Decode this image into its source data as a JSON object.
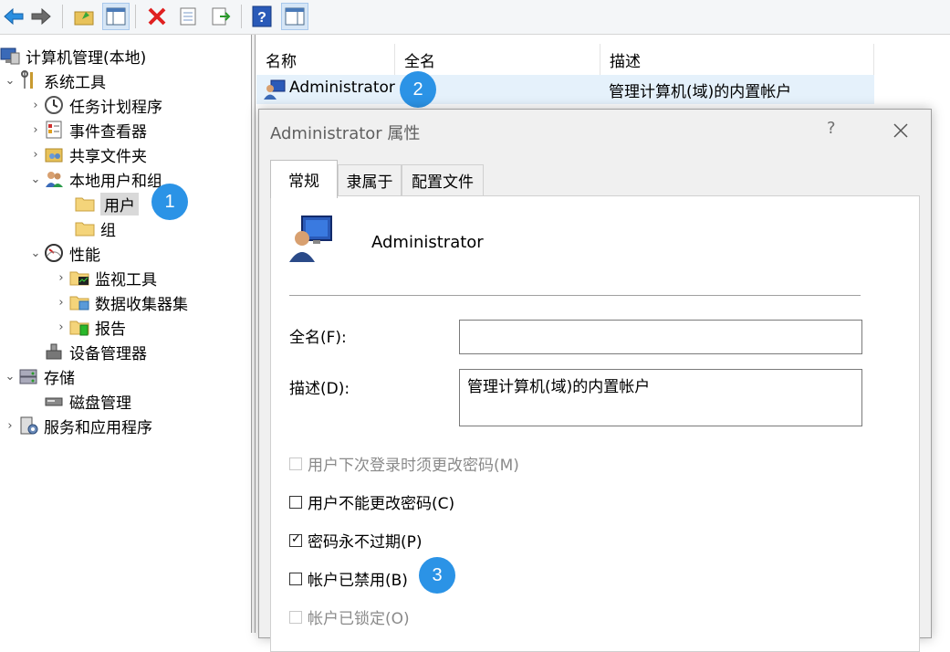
{
  "toolbar": {
    "buttons": [
      "back-icon",
      "forward-icon",
      "up-folder-icon",
      "show-hide-tree-icon",
      "delete-icon",
      "properties-icon",
      "export-icon",
      "help-icon",
      "action-pane-icon"
    ]
  },
  "tree": {
    "root": "计算机管理(本地)",
    "system_tools": "系统工具",
    "task_scheduler": "任务计划程序",
    "event_viewer": "事件查看器",
    "shared_folders": "共享文件夹",
    "local_users_groups": "本地用户和组",
    "users": "用户",
    "groups": "组",
    "performance": "性能",
    "monitoring_tools": "监视工具",
    "data_collector_sets": "数据收集器集",
    "reports": "报告",
    "device_manager": "设备管理器",
    "storage": "存储",
    "disk_management": "磁盘管理",
    "services_apps": "服务和应用程序"
  },
  "list": {
    "columns": [
      "名称",
      "全名",
      "描述"
    ],
    "rows": [
      {
        "name": "Administrator",
        "fullname": "",
        "description": "管理计算机(域)的内置帐户"
      }
    ]
  },
  "badges": [
    "1",
    "2",
    "3"
  ],
  "dialog": {
    "title": "Administrator 属性",
    "help": "?",
    "tabs": [
      "常规",
      "隶属于",
      "配置文件"
    ],
    "user_name": "Administrator",
    "fullname_label": "全名(F):",
    "fullname_value": "",
    "description_label": "描述(D):",
    "description_value": "管理计算机(域)的内置帐户",
    "checkboxes": [
      {
        "label": "用户下次登录时须更改密码(M)",
        "checked": false,
        "disabled": true
      },
      {
        "label": "用户不能更改密码(C)",
        "checked": false,
        "disabled": false
      },
      {
        "label": "密码永不过期(P)",
        "checked": true,
        "disabled": false
      },
      {
        "label": "帐户已禁用(B)",
        "checked": false,
        "disabled": false
      },
      {
        "label": "帐户已锁定(O)",
        "checked": false,
        "disabled": true
      }
    ]
  },
  "colors": {
    "badge": "#2b93e6",
    "selection": "#e5f1fb"
  }
}
